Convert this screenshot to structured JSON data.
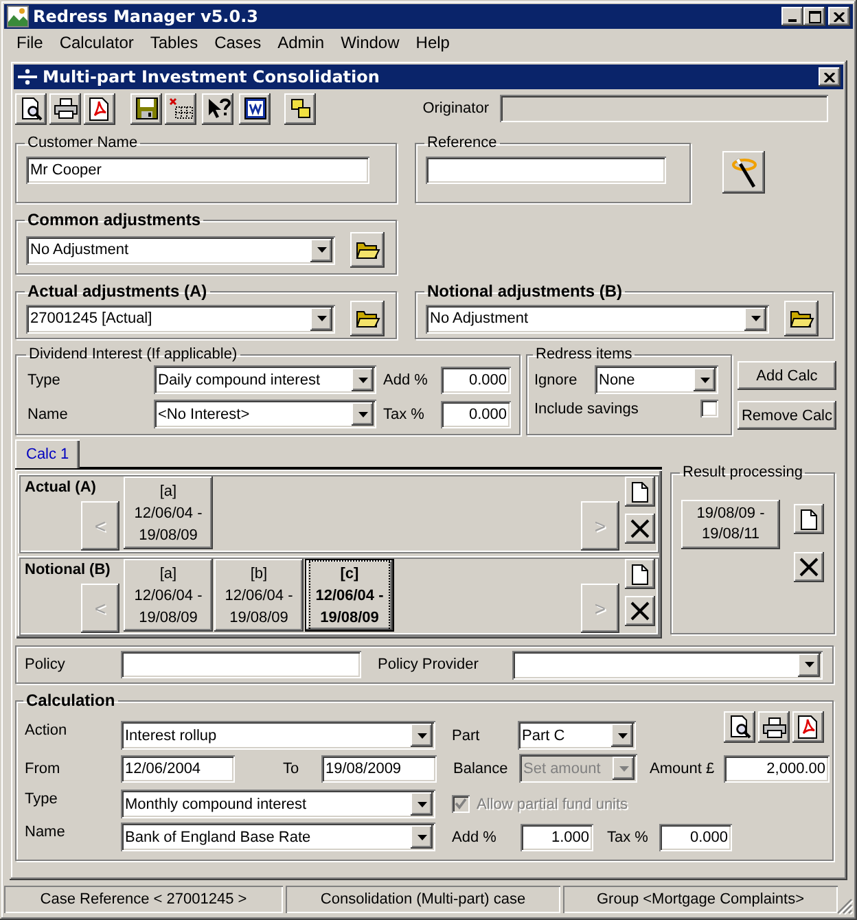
{
  "app_window": {
    "title": "Redress Manager v5.0.3"
  },
  "menu": [
    "File",
    "Calculator",
    "Tables",
    "Cases",
    "Admin",
    "Window",
    "Help"
  ],
  "child_window": {
    "title": "Multi-part Investment Consolidation"
  },
  "originator": {
    "label": "Originator"
  },
  "customer_name": {
    "label": "Customer Name",
    "value": "Mr Cooper"
  },
  "reference": {
    "label": "Reference"
  },
  "common_adjustments": {
    "label": "Common adjustments",
    "value": "No Adjustment"
  },
  "actual_adjustments": {
    "label": "Actual adjustments (A)",
    "value": "27001245 [Actual]"
  },
  "notional_adjustments": {
    "label": "Notional adjustments (B)",
    "value": "No Adjustment"
  },
  "dividend_interest": {
    "label": "Dividend Interest (If applicable)",
    "type_label": "Type",
    "type": "Daily compound interest",
    "name_label": "Name",
    "name": "<No Interest>",
    "add_label": "Add %",
    "add": "0.000",
    "tax_label": "Tax %",
    "tax": "0.000"
  },
  "redress_items": {
    "label": "Redress items",
    "ignore_label": "Ignore",
    "ignore": "None",
    "include_savings": {
      "label": "Include savings",
      "checked": false
    }
  },
  "side_buttons": [
    "Add Calc",
    "Remove Calc"
  ],
  "tabs": [
    {
      "label": "Calc 1",
      "selected": true
    }
  ],
  "part_groups": [
    {
      "label": "Actual (A)",
      "prev": {
        "label": "<",
        "disabled": true
      },
      "next": {
        "label": ">",
        "disabled": true
      },
      "parts": [
        {
          "lines": [
            "[a]",
            "12/06/04 -",
            "19/08/09"
          ],
          "selected": false
        }
      ]
    },
    {
      "label": "Notional (B)",
      "prev": {
        "label": "<",
        "disabled": true
      },
      "next": {
        "label": ">",
        "disabled": true
      },
      "parts": [
        {
          "lines": [
            "[a]",
            "12/06/04 -",
            "19/08/09"
          ],
          "selected": false
        },
        {
          "lines": [
            "[b]",
            "12/06/04 -",
            "19/08/09"
          ],
          "selected": false
        },
        {
          "lines": [
            "[c]",
            "12/06/04 -",
            "19/08/09"
          ],
          "selected": true
        }
      ]
    }
  ],
  "result_processing": {
    "label": "Result processing",
    "periods": [
      {
        "lines": [
          "19/08/09 -",
          "19/08/11"
        ]
      }
    ]
  },
  "policy": {
    "label": "Policy"
  },
  "policy_provider": {
    "label": "Policy Provider"
  },
  "calculation": {
    "label": "Calculation",
    "action_label": "Action",
    "action": "Interest rollup",
    "part_label": "Part",
    "part": "Part C",
    "from_label": "From",
    "from": "12/06/2004",
    "to_label": "To",
    "to": "19/08/2009",
    "balance_label": "Balance",
    "balance": {
      "value": "Set amount",
      "disabled": true
    },
    "amount_label": "Amount £",
    "amount": "2,000.00",
    "type_label": "Type",
    "type": "Monthly compound interest",
    "allow_partial": {
      "label": "Allow partial fund units",
      "checked": true,
      "disabled": true
    },
    "name_label": "Name",
    "name": "Bank of England Base Rate",
    "add_label": "Add %",
    "add": "1.000",
    "tax_label": "Tax %",
    "tax": "0.000"
  },
  "status_bar": [
    "Case Reference < 27001245 >",
    "Consolidation (Multi-part) case",
    "Group <Mortgage Complaints>"
  ]
}
